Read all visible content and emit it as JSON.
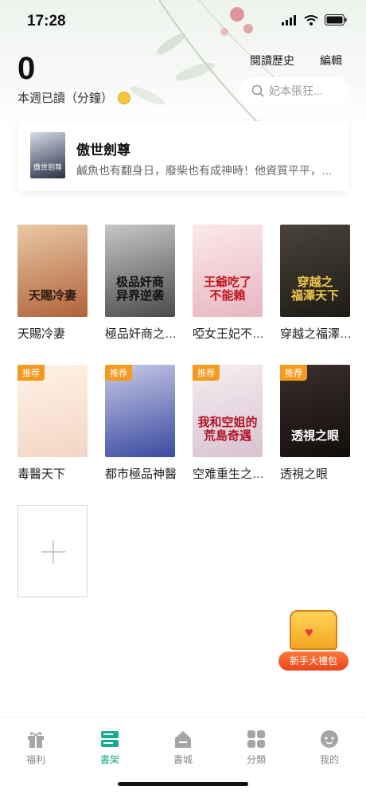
{
  "status": {
    "time": "17:28"
  },
  "stats": {
    "weekly_count": "0",
    "weekly_label": "本週已讀（分鐘）"
  },
  "header": {
    "history_label": "閱讀歷史",
    "edit_label": "編輯",
    "search_placeholder": "妃本張狂..."
  },
  "current_book": {
    "title": "傲世劍尊",
    "description": "鹹魚也有翻身日，廢柴也有成神時！他資質平平，…",
    "cover_text": "傲世劍尊"
  },
  "shelf": [
    {
      "title": "天賜冷妻",
      "cover_text": "天賜冷妻",
      "badge": "",
      "colors": [
        "#e9c9a3",
        "#b0623b"
      ],
      "text_color": "#2a1a10"
    },
    {
      "title": "極品奸商之異界逆襲",
      "cover_text": "极品奸商\n异界逆袭",
      "badge": "",
      "colors": [
        "#c7c7c7",
        "#4b4b4b"
      ],
      "text_color": "#111111"
    },
    {
      "title": "啞女王妃不能吃",
      "cover_text": "王爺吃了\n不能賴",
      "badge": "",
      "colors": [
        "#fbe9e8",
        "#e7b6c2"
      ],
      "text_color": "#c0161f"
    },
    {
      "title": "穿越之福澤天下",
      "cover_text": "穿越之\n福澤天下",
      "badge": "",
      "colors": [
        "#4a4438",
        "#1e1b17"
      ],
      "text_color": "#f2c94c"
    },
    {
      "title": "毒醫天下",
      "cover_text": "",
      "badge": "推荐",
      "colors": [
        "#fff3e6",
        "#f2d5c4"
      ],
      "text_color": "#333333"
    },
    {
      "title": "都市極品神醫",
      "cover_text": "",
      "badge": "推荐",
      "colors": [
        "#c6c9e6",
        "#3a4aa0"
      ],
      "text_color": "#ffffff"
    },
    {
      "title": "空难重生之荒岛奇遇",
      "cover_text": "我和空姐的\n荒島奇遇",
      "badge": "推荐",
      "colors": [
        "#f6eef2",
        "#d8c2cf"
      ],
      "text_color": "#b0142a"
    },
    {
      "title": "透視之眼",
      "cover_text": "透視之眼",
      "badge": "推荐",
      "colors": [
        "#3a2f2c",
        "#120d0c"
      ],
      "text_color": "#ffffff"
    }
  ],
  "gift": {
    "label": "新手大禮包"
  },
  "tabs": [
    {
      "label": "福利",
      "icon": "gift-icon",
      "active": false
    },
    {
      "label": "書架",
      "icon": "bookshelf-icon",
      "active": true
    },
    {
      "label": "書城",
      "icon": "store-icon",
      "active": false
    },
    {
      "label": "分類",
      "icon": "category-icon",
      "active": false
    },
    {
      "label": "我的",
      "icon": "profile-icon",
      "active": false
    }
  ],
  "colors": {
    "accent": "#1aaa8d",
    "badge": "#f39a21",
    "inactive_tab": "#888888"
  }
}
